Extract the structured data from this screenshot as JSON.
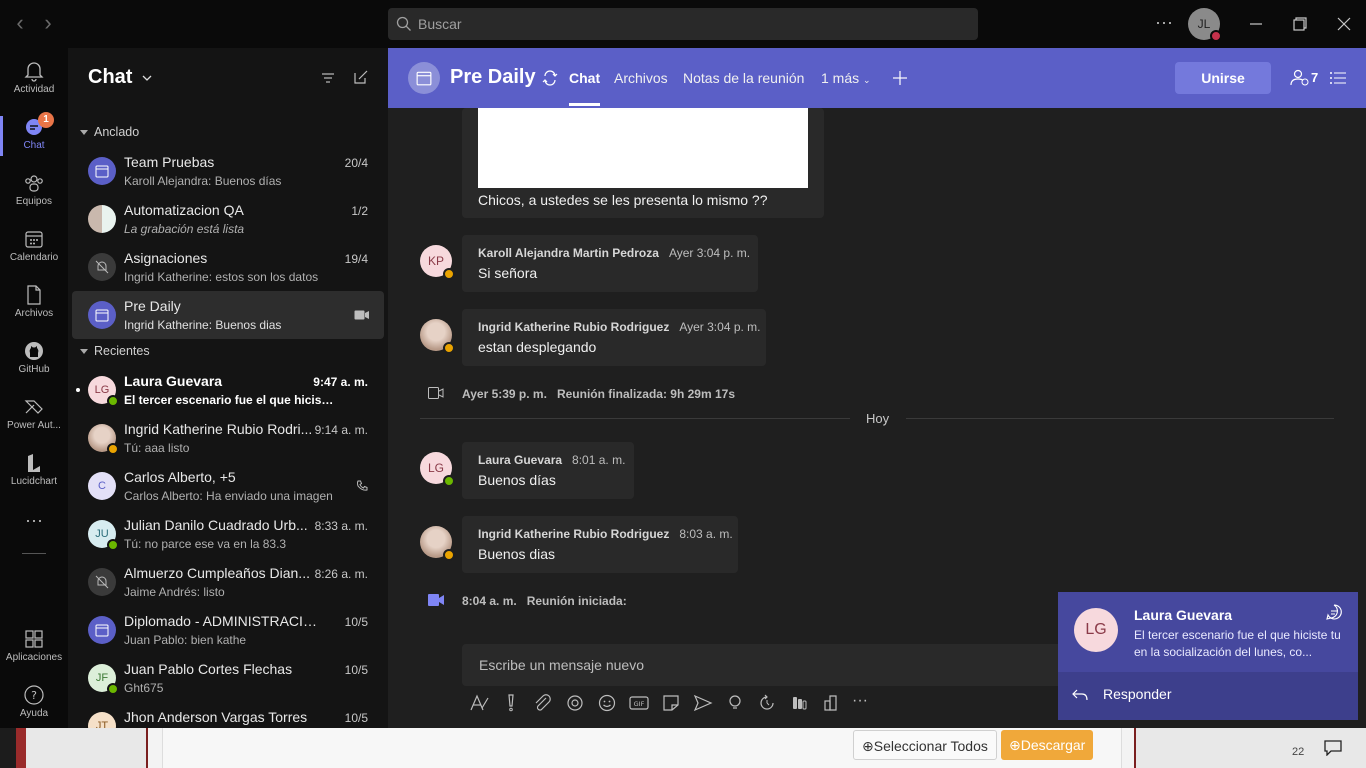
{
  "titlebar": {
    "search_placeholder": "Buscar",
    "user_initials": "JL"
  },
  "rail": {
    "items": [
      {
        "label": "Actividad",
        "icon": "bell-icon"
      },
      {
        "label": "Chat",
        "icon": "chat-icon",
        "badge": "1"
      },
      {
        "label": "Equipos",
        "icon": "teams-icon"
      },
      {
        "label": "Calendario",
        "icon": "calendar-icon"
      },
      {
        "label": "Archivos",
        "icon": "file-icon"
      },
      {
        "label": "GitHub",
        "icon": "github-icon"
      },
      {
        "label": "Power Aut...",
        "icon": "power-automate-icon"
      },
      {
        "label": "Lucidchart",
        "icon": "lucidchart-icon"
      }
    ],
    "apps_label": "Aplicaciones",
    "help_label": "Ayuda"
  },
  "chat_list": {
    "title": "Chat",
    "pinned_label": "Anclado",
    "recent_label": "Recientes",
    "pinned": [
      {
        "name": "Team Pruebas",
        "preview": "Karoll Alejandra: Buenos días",
        "time": "20/4"
      },
      {
        "name": "Automatizacion QA",
        "preview": "La grabación está lista",
        "time": "1/2"
      },
      {
        "name": "Asignaciones",
        "preview": "Ingrid Katherine: estos son los datos",
        "time": "19/4"
      },
      {
        "name": "Pre Daily",
        "preview": "Ingrid Katherine: Buenos dias",
        "time": ""
      }
    ],
    "recent": [
      {
        "name": "Laura Guevara",
        "preview": "El tercer escenario fue el que hiciste t...",
        "time": "9:47 a. m.",
        "initials": "LG"
      },
      {
        "name": "Ingrid Katherine Rubio Rodri...",
        "preview": "Tú: aaa listo",
        "time": "9:14 a. m."
      },
      {
        "name": "Carlos Alberto, +5",
        "preview": "Carlos Alberto: Ha enviado una imagen",
        "time": "",
        "initials": "C"
      },
      {
        "name": "Julian Danilo Cuadrado Urb...",
        "preview": "Tú: no parce ese va en la 83.3",
        "time": "8:33 a. m.",
        "initials": "JU"
      },
      {
        "name": "Almuerzo Cumpleaños Dian...",
        "preview": "Jaime Andrés: listo",
        "time": "8:26 a. m."
      },
      {
        "name": "Diplomado - ADMINISTRACIÓN ...",
        "preview": "Juan Pablo: bien kathe",
        "time": "10/5"
      },
      {
        "name": "Juan Pablo Cortes Flechas",
        "preview": "Ght675",
        "time": "10/5",
        "initials": "JF"
      },
      {
        "name": "Jhon Anderson Vargas Torres",
        "preview": "",
        "time": "10/5",
        "initials": "JT"
      }
    ]
  },
  "header": {
    "title": "Pre Daily",
    "tabs": [
      "Chat",
      "Archivos",
      "Notas de la reunión",
      "1 más"
    ],
    "join_label": "Unirse",
    "participants": "7"
  },
  "conversation": {
    "image_caption": "Chicos, a ustedes se les presenta lo mismo ??",
    "messages": [
      {
        "author": "Karoll Alejandra Martin Pedroza",
        "time": "Ayer 3:04 p. m.",
        "text": "Si señora",
        "initials": "KP"
      },
      {
        "author": "Ingrid Katherine Rubio Rodriguez",
        "time": "Ayer 3:04 p. m.",
        "text": "estan desplegando"
      },
      {
        "author": "Laura Guevara",
        "time": "8:01 a. m.",
        "text": "Buenos días",
        "initials": "LG"
      },
      {
        "author": "Ingrid Katherine Rubio Rodriguez",
        "time": "8:03 a. m.",
        "text": "Buenos dias"
      }
    ],
    "meeting_ended": {
      "time": "Ayer 5:39 p. m.",
      "text": "Reunión finalizada: 9h 29m 17s"
    },
    "day_divider": "Hoy",
    "meeting_started": {
      "time": "8:04 a. m.",
      "text": "Reunión iniciada:"
    },
    "compose_placeholder": "Escribe un mensaje nuevo"
  },
  "toast": {
    "initials": "LG",
    "name": "Laura Guevara",
    "message": "El tercer escenario fue el que hiciste tu en la socialización del lunes, co...",
    "reply_label": "Responder"
  },
  "taskbar": {
    "select_all": "Seleccionar Todos",
    "download": "Descargar",
    "clock_fragment": "22"
  },
  "colors": {
    "accent": "#5b5fc7",
    "online": "#6bb700",
    "away": "#eaa300",
    "download": "#f0a83a"
  }
}
